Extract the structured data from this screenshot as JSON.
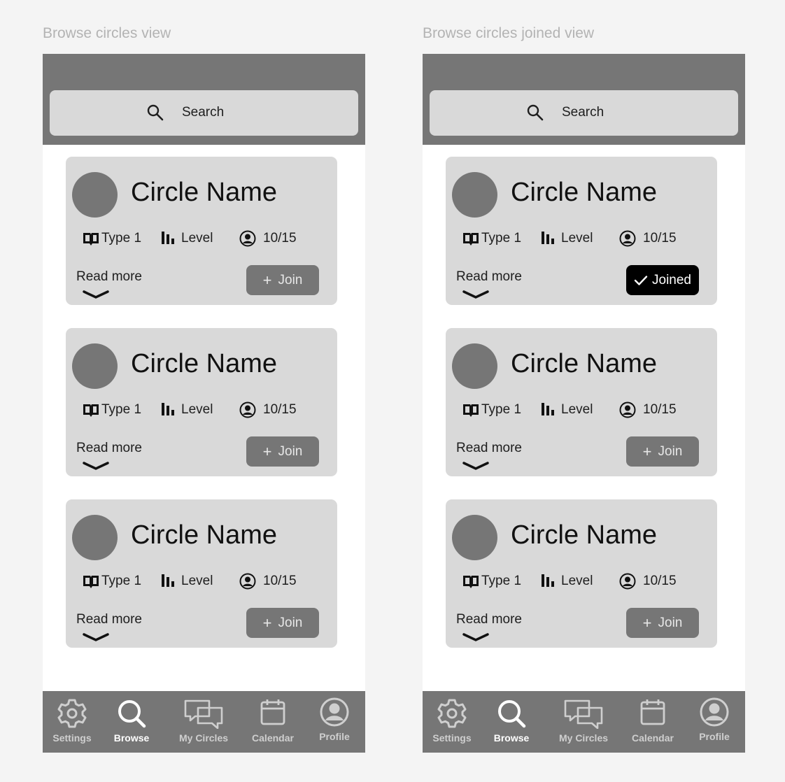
{
  "views": [
    {
      "title": "Browse circles view",
      "search_placeholder": "Search",
      "cards": [
        {
          "name": "Circle Name",
          "type": "Type 1",
          "level": "Level",
          "members": "10/15",
          "read_more": "Read more",
          "button": "Join",
          "joined": false
        },
        {
          "name": "Circle Name",
          "type": "Type 1",
          "level": "Level",
          "members": "10/15",
          "read_more": "Read more",
          "button": "Join",
          "joined": false
        },
        {
          "name": "Circle Name",
          "type": "Type 1",
          "level": "Level",
          "members": "10/15",
          "read_more": "Read more",
          "button": "Join",
          "joined": false
        }
      ],
      "nav": [
        {
          "label": "Settings",
          "icon": "gear-icon"
        },
        {
          "label": "Browse",
          "icon": "search-icon",
          "active": true
        },
        {
          "label": "My Circles",
          "icon": "chat-bubbles-icon"
        },
        {
          "label": "Calendar",
          "icon": "calendar-icon"
        },
        {
          "label": "Profile",
          "icon": "user-circle-icon"
        }
      ]
    },
    {
      "title": "Browse circles joined view",
      "search_placeholder": "Search",
      "cards": [
        {
          "name": "Circle Name",
          "type": "Type 1",
          "level": "Level",
          "members": "10/15",
          "read_more": "Read more",
          "button": "Joined",
          "joined": true
        },
        {
          "name": "Circle Name",
          "type": "Type 1",
          "level": "Level",
          "members": "10/15",
          "read_more": "Read more",
          "button": "Join",
          "joined": false
        },
        {
          "name": "Circle Name",
          "type": "Type 1",
          "level": "Level",
          "members": "10/15",
          "read_more": "Read more",
          "button": "Join",
          "joined": false
        }
      ],
      "nav": [
        {
          "label": "Settings",
          "icon": "gear-icon"
        },
        {
          "label": "Browse",
          "icon": "search-icon",
          "active": true
        },
        {
          "label": "My Circles",
          "icon": "chat-bubbles-icon"
        },
        {
          "label": "Calendar",
          "icon": "calendar-icon"
        },
        {
          "label": "Profile",
          "icon": "user-circle-icon"
        }
      ]
    }
  ],
  "colors": {
    "background": "#f4f4f4",
    "header": "#767676",
    "card": "#d9d9d9",
    "avatar": "#767676",
    "join_button": "#767676",
    "joined_button": "#000000"
  }
}
